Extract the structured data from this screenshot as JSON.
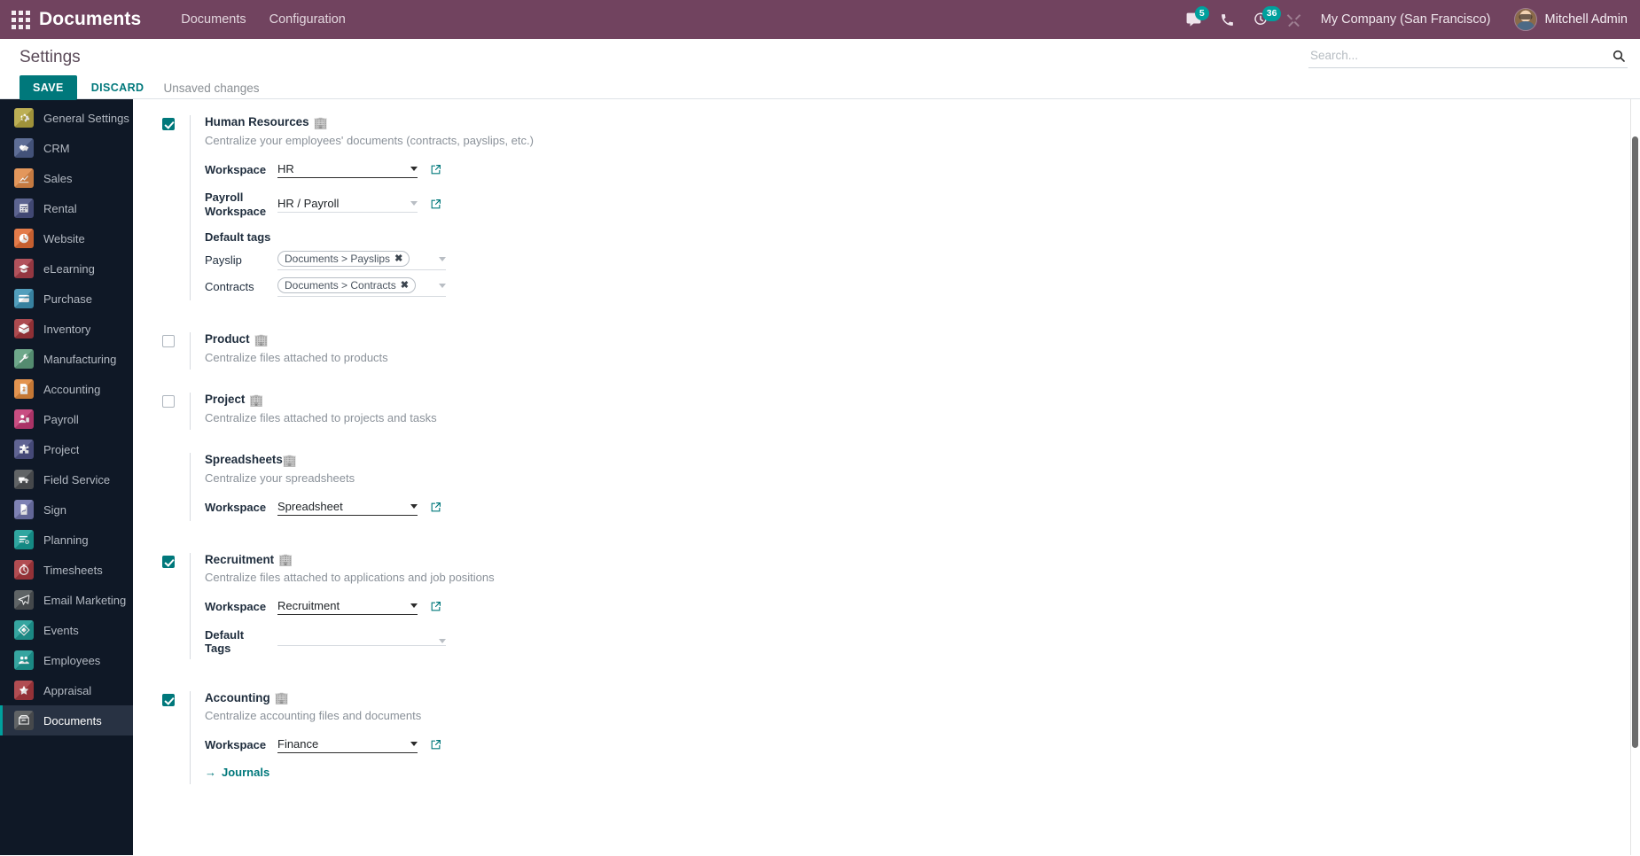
{
  "navbar": {
    "apps_icon": "apps-grid-icon",
    "brand": "Documents",
    "menus": [
      {
        "label": "Documents",
        "name": "navbar-menu-documents"
      },
      {
        "label": "Configuration",
        "name": "navbar-menu-configuration"
      }
    ],
    "messages_badge": "5",
    "activities_badge": "36",
    "company": "My Company (San Francisco)",
    "user": "Mitchell Admin"
  },
  "control_panel": {
    "title": "Settings",
    "save_label": "SAVE",
    "discard_label": "DISCARD",
    "status": "Unsaved changes",
    "search_placeholder": "Search..."
  },
  "sidebar": {
    "items": [
      {
        "label": "General Settings",
        "icon": "gear-icon",
        "color": "#b5a642",
        "active": false
      },
      {
        "label": "CRM",
        "icon": "handshake-icon",
        "color": "#4c5d8a",
        "active": false
      },
      {
        "label": "Sales",
        "icon": "chart-up-icon",
        "color": "#e08b4a",
        "active": false
      },
      {
        "label": "Rental",
        "icon": "calendar-icon",
        "color": "#4a5283",
        "active": false
      },
      {
        "label": "Website",
        "icon": "globe-icon",
        "color": "#e06c36",
        "active": false
      },
      {
        "label": "eLearning",
        "icon": "graduation-icon",
        "color": "#a83f4a",
        "active": false
      },
      {
        "label": "Purchase",
        "icon": "card-icon",
        "color": "#3f93b5",
        "active": false
      },
      {
        "label": "Inventory",
        "icon": "box-icon",
        "color": "#a3373c",
        "active": false
      },
      {
        "label": "Manufacturing",
        "icon": "wrench-icon",
        "color": "#5f9e7e",
        "active": false
      },
      {
        "label": "Accounting",
        "icon": "invoice-icon",
        "color": "#e0883c",
        "active": false
      },
      {
        "label": "Payroll",
        "icon": "person-pay-icon",
        "color": "#c23a74",
        "active": false
      },
      {
        "label": "Project",
        "icon": "puzzle-icon",
        "color": "#4e5387",
        "active": false
      },
      {
        "label": "Field Service",
        "icon": "truck-icon",
        "color": "#4f5255",
        "active": false
      },
      {
        "label": "Sign",
        "icon": "sign-doc-icon",
        "color": "#6f74ab",
        "active": false
      },
      {
        "label": "Planning",
        "icon": "planning-icon",
        "color": "#189c95",
        "active": false
      },
      {
        "label": "Timesheets",
        "icon": "stopwatch-icon",
        "color": "#a8393f",
        "active": false
      },
      {
        "label": "Email Marketing",
        "icon": "paperplane-icon",
        "color": "#4d5255",
        "active": false
      },
      {
        "label": "Events",
        "icon": "ticket-icon",
        "color": "#1f9b95",
        "active": false
      },
      {
        "label": "Employees",
        "icon": "people-icon",
        "color": "#1f9b95",
        "active": false
      },
      {
        "label": "Appraisal",
        "icon": "star-icon",
        "color": "#a8393f",
        "active": false
      },
      {
        "label": "Documents",
        "icon": "documents-icon",
        "color": "#4f5255",
        "active": true
      }
    ]
  },
  "settings": {
    "building_icon": "🏢",
    "sections": [
      {
        "name": "human-resources",
        "checkbox": true,
        "title": "Human Resources",
        "description": "Centralize your employees' documents (contracts, payslips, etc.)",
        "fields": [
          {
            "label": "Workspace",
            "value": "HR",
            "disabled": false,
            "external": true
          },
          {
            "label": "Payroll Workspace",
            "value": "HR / Payroll",
            "disabled": true,
            "external": true
          }
        ],
        "tags_header": "Default tags",
        "tags": [
          {
            "label": "Payslip",
            "value": "Documents > Payslips"
          },
          {
            "label": "Contracts",
            "value": "Documents > Contracts"
          }
        ]
      },
      {
        "name": "product",
        "checkbox": false,
        "title": "Product",
        "description": "Centralize files attached to products",
        "fields": []
      },
      {
        "name": "project",
        "checkbox": false,
        "title": "Project",
        "description": "Centralize files attached to projects and tasks",
        "fields": []
      },
      {
        "name": "spreadsheets",
        "checkbox": null,
        "title": "Spreadsheets",
        "description": "Centralize your spreadsheets",
        "fields": [
          {
            "label": "Workspace",
            "value": "Spreadsheet",
            "disabled": false,
            "external": true
          }
        ]
      },
      {
        "name": "recruitment",
        "checkbox": true,
        "title": "Recruitment",
        "description": "Centralize files attached to applications and job positions",
        "fields": [
          {
            "label": "Workspace",
            "value": "Recruitment",
            "disabled": false,
            "external": true
          },
          {
            "label": "Default Tags",
            "value": "",
            "disabled": true,
            "external": false
          }
        ]
      },
      {
        "name": "accounting",
        "checkbox": true,
        "title": "Accounting",
        "description": "Centralize accounting files and documents",
        "fields": [
          {
            "label": "Workspace",
            "value": "Finance",
            "disabled": false,
            "external": true
          }
        ],
        "link": "Journals"
      }
    ]
  },
  "colors": {
    "navbar": "#71435f",
    "accent": "#00787B",
    "sidebar_bg": "#0f1826",
    "badge": "#00A09D"
  }
}
